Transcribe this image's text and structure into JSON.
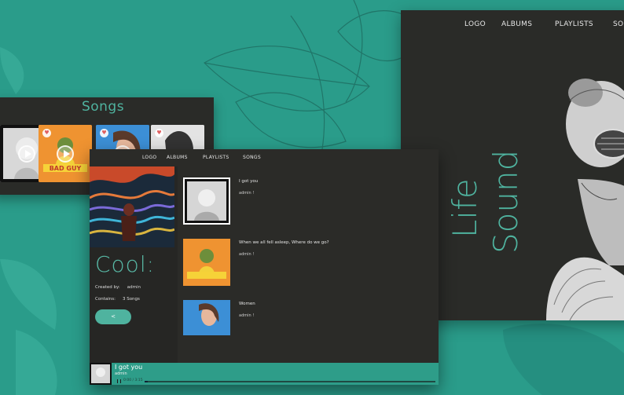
{
  "right_window": {
    "nav": [
      "LOGO",
      "ALBUMS",
      "PLAYLISTS",
      "SO"
    ],
    "headline_word_1": "Life",
    "headline_word_2": "Sound"
  },
  "songs_window": {
    "title": "Songs",
    "tiles": [
      {
        "color": "#e9e9e9"
      },
      {
        "color": "#f09a35",
        "text": "BAD GUY"
      },
      {
        "color": "#3d8fd8"
      },
      {
        "color": "#dcdcdc"
      }
    ]
  },
  "main_window": {
    "nav": [
      "LOGO",
      "ALBUMS",
      "PLAYLISTS",
      "SONGS"
    ],
    "playlist": {
      "title": "Cool:",
      "created_by_label": "Created by:",
      "created_by_value": "admin",
      "contains_label": "Contains:",
      "contains_value": "3 Songs"
    },
    "songs": [
      {
        "title": "I got you",
        "artist": "admin !"
      },
      {
        "title": "When we all fell asleep, Where do we go?",
        "artist": "admin !"
      },
      {
        "title": "Women",
        "artist": "admin !"
      }
    ],
    "player": {
      "title": "I got you",
      "artist": "admin",
      "time": "0:00 / 3:15",
      "progress": 0.01
    }
  },
  "colors": {
    "background": "#2a9c8a",
    "panel": "#2b2b28",
    "accent": "#4fb39f"
  }
}
